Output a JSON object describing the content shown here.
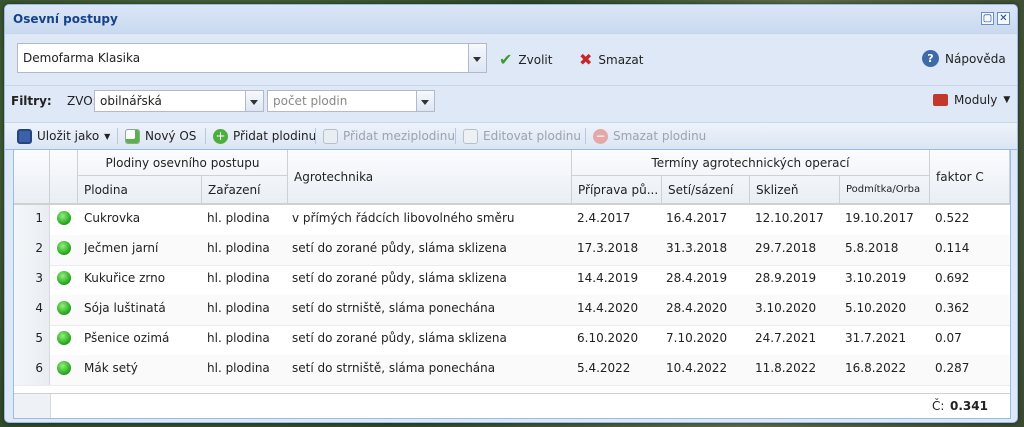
{
  "window": {
    "title": "Osevní postupy"
  },
  "selector": {
    "value": "Demofarma Klasika",
    "choose_label": "Zvolit",
    "delete_label": "Smazat",
    "help_label": "Nápověda"
  },
  "filters": {
    "label": "Filtry:",
    "zvo_label": "ZVO:",
    "zvo_value": "obilnářská",
    "count_placeholder": "počet plodin",
    "modules_label": "Moduly"
  },
  "toolbar": {
    "save_as": "Uložit jako",
    "new_os": "Nový OS",
    "add_crop": "Přidat plodinu",
    "add_intercrop": "Přidat meziplodinu",
    "edit_crop": "Editovat plodinu",
    "delete_crop": "Smazat plodinu"
  },
  "grid": {
    "group_crops": "Plodiny osevního postupu",
    "group_terms": "Termíny agrotechnických operací",
    "col_crop": "Plodina",
    "col_class": "Zařazení",
    "col_agro": "Agrotechnika",
    "col_prep": "Příprava pů...",
    "col_sow": "Setí/sázení",
    "col_harvest": "Sklizeň",
    "col_sub": "Podmítka/Orba",
    "col_c": "faktor C",
    "rows": [
      {
        "n": "1",
        "crop": "Cukrovka",
        "cls": "hl. plodina",
        "agro": "v přímých řádcích libovolného směru",
        "prep": "2.4.2017",
        "sow": "16.4.2017",
        "harvest": "12.10.2017",
        "sub": "19.10.2017",
        "c": "0.522"
      },
      {
        "n": "2",
        "crop": "Ječmen jarní",
        "cls": "hl. plodina",
        "agro": "setí do zorané půdy, sláma sklizena",
        "prep": "17.3.2018",
        "sow": "31.3.2018",
        "harvest": "29.7.2018",
        "sub": "5.8.2018",
        "c": "0.114"
      },
      {
        "n": "3",
        "crop": "Kukuřice zrno",
        "cls": "hl. plodina",
        "agro": "setí do zorané půdy, sláma sklizena",
        "prep": "14.4.2019",
        "sow": "28.4.2019",
        "harvest": "28.9.2019",
        "sub": "3.10.2019",
        "c": "0.692"
      },
      {
        "n": "4",
        "crop": "Sója luštinatá",
        "cls": "hl. plodina",
        "agro": "setí do strniště, sláma ponechána",
        "prep": "14.4.2020",
        "sow": "28.4.2020",
        "harvest": "3.10.2020",
        "sub": "5.10.2020",
        "c": "0.362"
      },
      {
        "n": "5",
        "crop": "Pšenice ozimá",
        "cls": "hl. plodina",
        "agro": "setí do zorané půdy, sláma sklizena",
        "prep": "6.10.2020",
        "sow": "7.10.2020",
        "harvest": "24.7.2021",
        "sub": "31.7.2021",
        "c": "0.07"
      },
      {
        "n": "6",
        "crop": "Mák setý",
        "cls": "hl. plodina",
        "agro": "setí do strniště, sláma ponechána",
        "prep": "5.4.2022",
        "sow": "10.4.2022",
        "harvest": "11.8.2022",
        "sub": "16.8.2022",
        "c": "0.287"
      }
    ],
    "footer_label": "Č:",
    "footer_value": "0.341"
  }
}
